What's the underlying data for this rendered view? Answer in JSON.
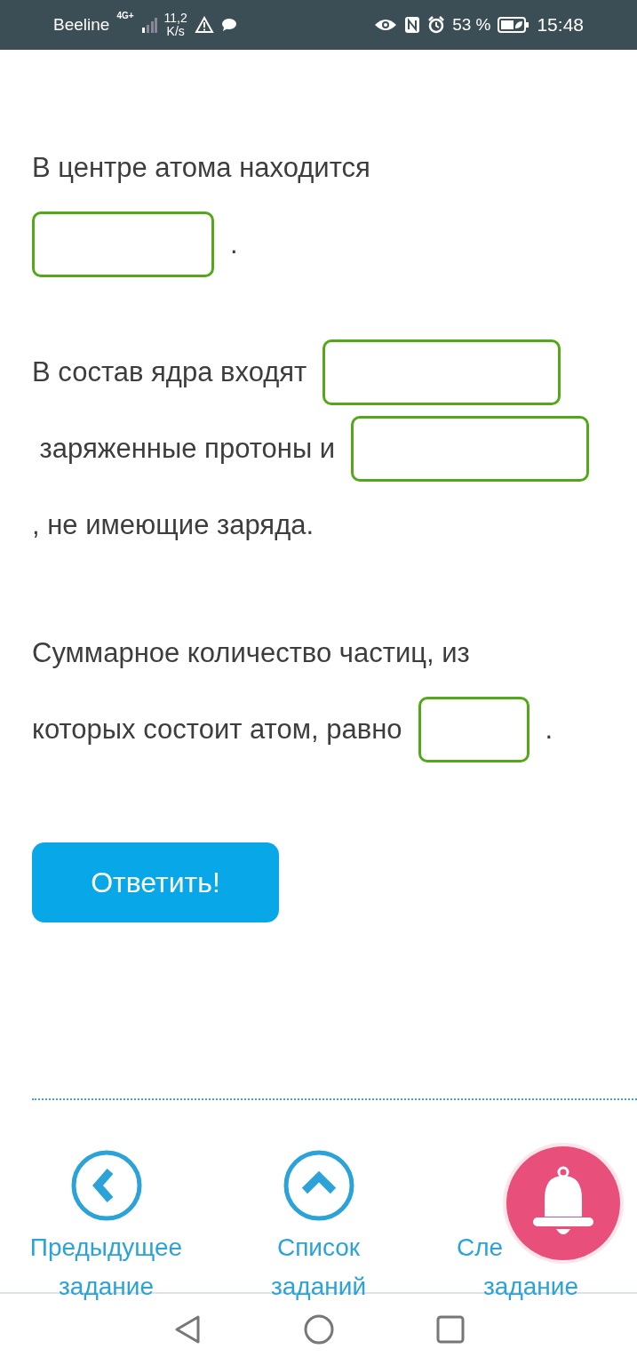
{
  "status_bar": {
    "carrier": "Beeline",
    "network": "4G+",
    "speed": "11,2",
    "speed_unit": "K/s",
    "battery": "53 %",
    "time": "15:48"
  },
  "exercise": {
    "paragraphs": [
      {
        "lines": [
          [
            {
              "kind": "text",
              "text": "В центре атома находится"
            }
          ],
          [
            {
              "kind": "blank"
            },
            {
              "kind": "text",
              "text": "."
            }
          ]
        ]
      },
      {
        "lines": [
          [
            {
              "kind": "text",
              "text": "В состав ядра входят"
            },
            {
              "kind": "blank"
            }
          ],
          [
            {
              "kind": "text",
              "text": " заряженные протоны и"
            },
            {
              "kind": "blank"
            }
          ],
          [
            {
              "kind": "text",
              "text": ", не имеющие заряда."
            }
          ]
        ]
      },
      {
        "lines": [
          [
            {
              "kind": "text",
              "text": "Суммарное количество частиц, из"
            }
          ],
          [
            {
              "kind": "text",
              "text": "которых состоит атом, равно"
            },
            {
              "kind": "blank"
            },
            {
              "kind": "text",
              "text": "."
            }
          ]
        ]
      }
    ],
    "submit": "Ответить!"
  },
  "nav": [
    {
      "kind": "previous",
      "lines": [
        "Предыдущее",
        "задание"
      ]
    },
    {
      "kind": "list",
      "lines": [
        "Список",
        "заданий"
      ]
    },
    {
      "kind": "next",
      "lines": [
        "Сле",
        "задание"
      ]
    }
  ]
}
